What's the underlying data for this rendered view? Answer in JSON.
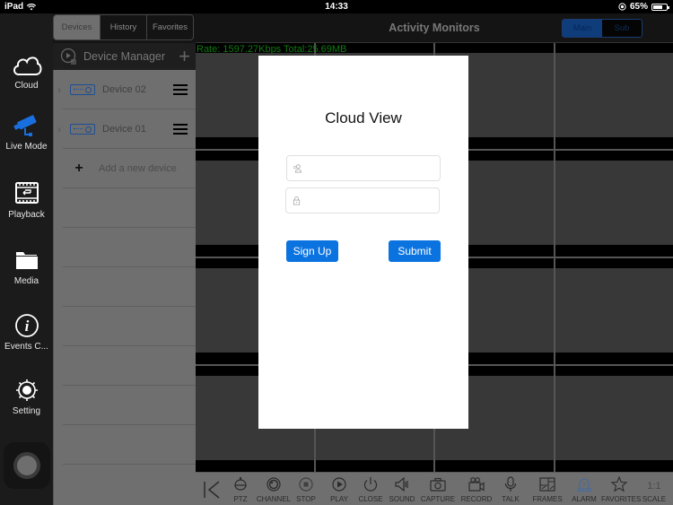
{
  "status_bar": {
    "device": "iPad",
    "time": "14:33",
    "battery": "65%"
  },
  "left_nav": {
    "items": [
      {
        "id": "cloud",
        "label": "Cloud",
        "icon": "cloud-icon",
        "active": false
      },
      {
        "id": "live-mode",
        "label": "Live Mode",
        "icon": "camera-icon",
        "active": true
      },
      {
        "id": "playback",
        "label": "Playback",
        "icon": "film-replay-icon",
        "active": false
      },
      {
        "id": "media",
        "label": "Media",
        "icon": "folder-icon",
        "active": false
      },
      {
        "id": "events",
        "label": "Events C...",
        "icon": "info-icon",
        "active": false
      },
      {
        "id": "setting",
        "label": "Setting",
        "icon": "gear-icon",
        "active": false
      }
    ],
    "active_color": "#1a6fe0"
  },
  "device_panel": {
    "tabs": [
      {
        "label": "Devices",
        "active": true
      },
      {
        "label": "History",
        "active": false
      },
      {
        "label": "Favorites",
        "active": false
      }
    ],
    "title": "Device Manager",
    "devices": [
      {
        "name": "Device 02"
      },
      {
        "name": "Device 01"
      }
    ],
    "add_label": "Add a new device"
  },
  "header": {
    "title": "Activity Monitors",
    "stream_toggle": [
      {
        "label": "Main",
        "active": true
      },
      {
        "label": "Sub",
        "active": false
      }
    ]
  },
  "video": {
    "rate_text": "Rate: 1597.27Kbps Total:25.69MB",
    "grid_rows": 4,
    "grid_cols": 4
  },
  "toolbar": {
    "items": [
      {
        "label": "PTZ",
        "icon": "ptz-icon"
      },
      {
        "label": "CHANNEL",
        "icon": "channel-icon"
      },
      {
        "label": "STOP",
        "icon": "stop-icon"
      },
      {
        "label": "PLAY",
        "icon": "play-icon"
      },
      {
        "label": "CLOSE",
        "icon": "power-icon"
      },
      {
        "label": "SOUND",
        "icon": "speaker-icon"
      },
      {
        "label": "CAPTURE",
        "icon": "camera-capture-icon"
      },
      {
        "label": "RECORD",
        "icon": "video-record-icon"
      },
      {
        "label": "TALK",
        "icon": "microphone-icon"
      },
      {
        "label": "FRAMES",
        "icon": "frames-icon"
      },
      {
        "label": "ALARM",
        "icon": "alarm-icon"
      },
      {
        "label": "FAVORITES",
        "icon": "star-icon"
      },
      {
        "label": "SCALE",
        "icon": "scale-icon",
        "glyph": "1:1"
      }
    ]
  },
  "modal": {
    "title": "Cloud View",
    "username": {
      "value": "",
      "placeholder": ""
    },
    "password": {
      "value": "",
      "placeholder": ""
    },
    "sign_up_label": "Sign Up",
    "submit_label": "Submit",
    "button_color": "#0b73e0"
  }
}
